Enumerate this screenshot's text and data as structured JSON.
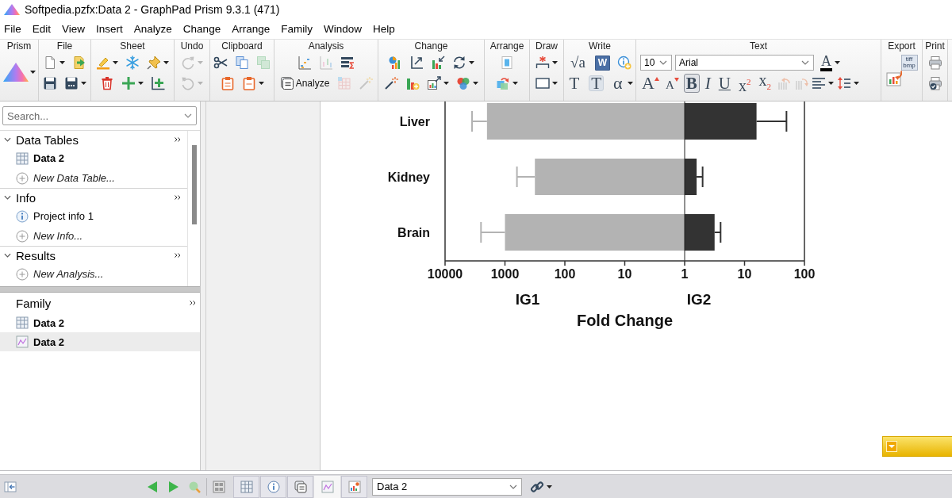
{
  "window": {
    "title": "Softpedia.pzfx:Data 2 - GraphPad Prism 9.3.1 (471)"
  },
  "menu": [
    "File",
    "Edit",
    "View",
    "Insert",
    "Analyze",
    "Change",
    "Arrange",
    "Family",
    "Window",
    "Help"
  ],
  "ribbon": {
    "groups": [
      {
        "label": "Prism"
      },
      {
        "label": "File"
      },
      {
        "label": "Sheet"
      },
      {
        "label": "Undo",
        "tools": [
          {
            "disabled": true
          },
          {
            "disabled": true
          }
        ]
      },
      {
        "label": "Clipboard",
        "tools": [
          {
            "disabled": false
          },
          {
            "disabled": false
          },
          {
            "disabled": true
          },
          {
            "disabled": false
          },
          {
            "disabled": false
          }
        ]
      },
      {
        "label": "Analysis",
        "analyze_button": "Analyze",
        "tools": [
          {
            "disabled": false
          },
          {
            "disabled": true
          },
          {
            "disabled": false
          },
          {
            "disabled": false
          },
          {
            "disabled": true
          },
          {
            "disabled": true
          }
        ]
      },
      {
        "label": "Change"
      },
      {
        "label": "Arrange"
      },
      {
        "label": "Draw"
      },
      {
        "label": "Write",
        "glyphs": [
          "√a",
          "W",
          "T",
          "T",
          "α"
        ]
      },
      {
        "label": "Text",
        "font_size": "10",
        "font": "Arial",
        "color_glyph": "A",
        "format_tools": [
          {
            "glyph": "A",
            "on": false
          },
          {
            "glyph": "A",
            "on": false
          },
          {
            "glyph": "B",
            "on": true
          },
          {
            "glyph": "I",
            "on": false
          },
          {
            "glyph": "U",
            "on": false
          },
          {
            "glyph": "x$^{2}$",
            "on": false
          },
          {
            "glyph": "x$_{2}$",
            "on": false
          }
        ],
        "tools": [
          {
            "disabled": true
          },
          {
            "disabled": true
          }
        ]
      },
      {
        "label": "Export",
        "file_types": "tiff bmp"
      },
      {
        "label": "Print"
      }
    ]
  },
  "navigator": {
    "search": {
      "placeholder": "Search..."
    },
    "sections": [
      {
        "title": "Data Tables",
        "expanded": true,
        "items": [
          {
            "kind": "table",
            "label": "Data 2",
            "selected": false
          },
          {
            "kind": "new",
            "label": "New Data Table...",
            "selected": false
          }
        ]
      },
      {
        "title": "Info",
        "expanded": true,
        "items": [
          {
            "kind": "info",
            "label": "Project info 1",
            "selected": false
          },
          {
            "kind": "new",
            "label": "New Info...",
            "selected": false
          }
        ]
      },
      {
        "title": "Results",
        "expanded": true,
        "items": [
          {
            "kind": "new",
            "label": "New Analysis...",
            "selected": false
          }
        ]
      }
    ],
    "family": {
      "title": "Family",
      "items": [
        {
          "kind": "table",
          "label": "Data 2",
          "selected": false
        },
        {
          "kind": "graph",
          "label": "Data 2",
          "selected": true
        }
      ]
    }
  },
  "sheet": {
    "plot": {
      "categories": [
        "Liver",
        "Kidney",
        "Brain"
      ],
      "groups": [
        {
          "label": "IG1",
          "color": "#b3b3b3"
        },
        {
          "label": "IG2",
          "color": "#333333"
        }
      ],
      "axis_ticks": [
        "10000",
        "1000",
        "100",
        "10",
        "1",
        "10",
        "100"
      ],
      "axis_title": "Fold Change"
    }
  },
  "bottom_bar": {
    "view_tabs": [
      {
        "kind": "table",
        "selected": false
      },
      {
        "kind": "info",
        "selected": false
      },
      {
        "kind": "notes",
        "selected": false
      },
      {
        "kind": "graph",
        "selected": true
      },
      {
        "kind": "layout",
        "selected": false
      }
    ],
    "sheet_select": {
      "value": "Data 2"
    }
  }
}
